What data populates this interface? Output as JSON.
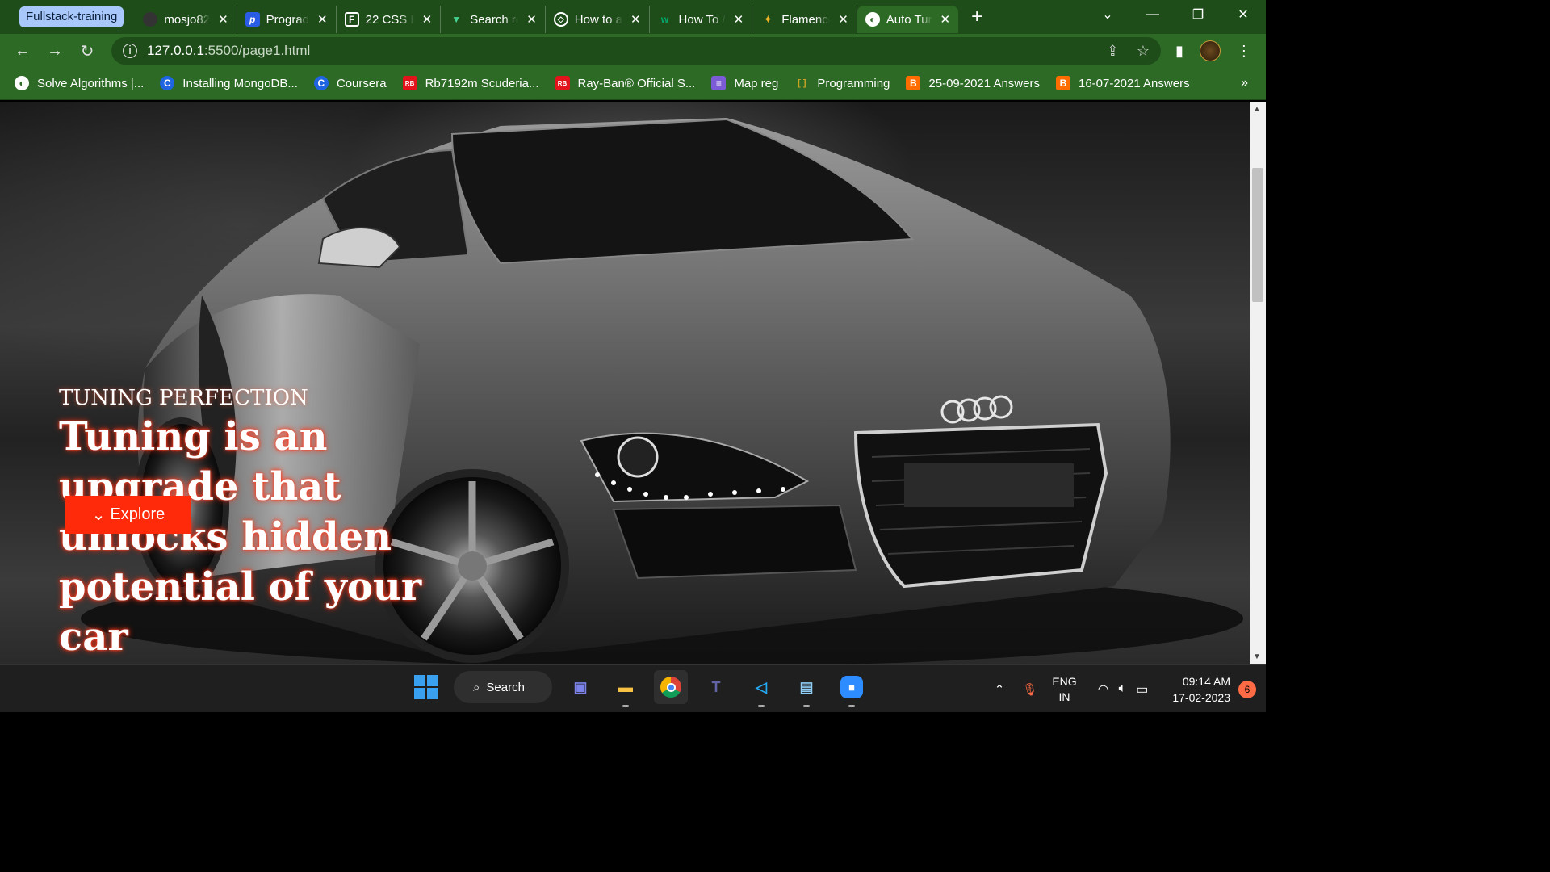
{
  "browser": {
    "tab_group": "Fullstack-training",
    "tabs": [
      {
        "title": "mosjo82",
        "icon": "github-icon"
      },
      {
        "title": "Prograd",
        "icon": "prograd-icon"
      },
      {
        "title": "22 CSS F",
        "icon": "freefrontend-icon"
      },
      {
        "title": "Search re",
        "icon": "vue-icon"
      },
      {
        "title": "How to a",
        "icon": "codepen-icon"
      },
      {
        "title": "How To /",
        "icon": "w3schools-icon"
      },
      {
        "title": "Flamenco",
        "icon": "flamenco-icon"
      },
      {
        "title": "Auto Tur",
        "icon": "globe-icon"
      }
    ],
    "url_host": "127.0.0.1",
    "url_path": ":5500/page1.html",
    "bookmarks": [
      {
        "label": "Solve Algorithms |...",
        "icon": "globe-icon"
      },
      {
        "label": "Installing MongoDB...",
        "icon": "coursera-icon"
      },
      {
        "label": "Coursera",
        "icon": "coursera-icon"
      },
      {
        "label": "Rb7192m Scuderia...",
        "icon": "rayban-icon"
      },
      {
        "label": "Ray-Ban® Official S...",
        "icon": "rayban-icon"
      },
      {
        "label": "Map reg",
        "icon": "list-icon"
      },
      {
        "label": "Programming",
        "icon": "folder-icon"
      },
      {
        "label": "25-09-2021 Answers",
        "icon": "blogger-icon"
      },
      {
        "label": "16-07-2021 Answers",
        "icon": "blogger-icon"
      }
    ],
    "more_bookmarks": "»"
  },
  "hero": {
    "kicker": "TUNING PERFECTION",
    "title": "Tuning is an upgrade that unlocks hidden potential of your car",
    "button": "Explore"
  },
  "taskbar": {
    "search_label": "Search",
    "lang_top": "ENG",
    "lang_bottom": "IN",
    "time": "09:14 AM",
    "date": "17-02-2023",
    "notification_count": "6"
  },
  "colors": {
    "chrome_green": "#2d6a25",
    "tab_green_dark": "#1e4d1a",
    "accent_red": "#ff2a0a"
  }
}
